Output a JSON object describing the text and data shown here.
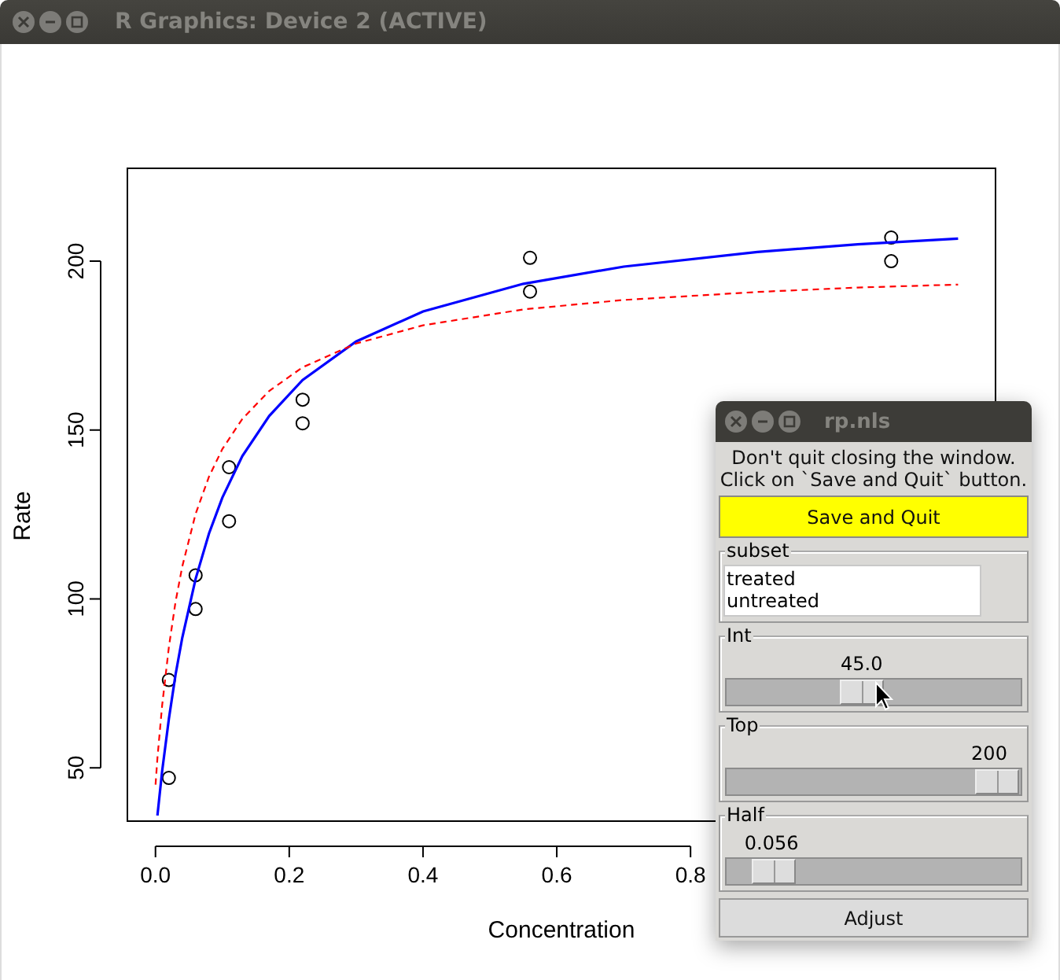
{
  "window": {
    "title": "R Graphics: Device 2 (ACTIVE)"
  },
  "plot": {
    "chart_data": {
      "type": "scatter",
      "xlabel": "Concentration",
      "ylabel": "Rate",
      "xlim": [
        -0.042,
        1.256
      ],
      "ylim": [
        34.2,
        227.5
      ],
      "xticks": [
        {
          "value": 0,
          "label": "0.0"
        },
        {
          "value": 0.2,
          "label": "0.2"
        },
        {
          "value": 0.4,
          "label": "0.4"
        },
        {
          "value": 0.6,
          "label": "0.6"
        },
        {
          "value": 0.8,
          "label": "0.8"
        }
      ],
      "yticks": [
        50,
        100,
        150,
        200
      ],
      "x": [
        0,
        0.003,
        0.01,
        0.02,
        0.03,
        0.04,
        0.06,
        0.08,
        0.1,
        0.13,
        0.17,
        0.22,
        0.3,
        0.4,
        0.55,
        0.7,
        0.9,
        1.05,
        1.2
      ],
      "series": [
        {
          "color": "#000000",
          "x": [
            0.02,
            0.02,
            0.06,
            0.06,
            0.11,
            0.11,
            0.22,
            0.22,
            0.56,
            0.56,
            1.1,
            1.1
          ],
          "values": [
            76,
            47,
            97,
            107,
            123,
            139,
            159,
            152,
            201,
            191,
            207,
            200
          ]
        },
        {
          "type": "line",
          "line_style": "solid",
          "color": "#0000ff",
          "values": [
            null,
            35.9,
            49,
            64.5,
            77.5,
            88.5,
            106,
            119.4,
            130,
            142.3,
            154.2,
            164.8,
            176.2,
            185.1,
            193.3,
            198.4,
            202.7,
            205,
            206.7
          ]
        },
        {
          "type": "line",
          "line_style": "dashed",
          "color": "#ff0000",
          "values": [
            45,
            52.9,
            68.5,
            85.8,
            99.1,
            109.6,
            125.2,
            136.2,
            144.4,
            153.3,
            161.6,
            168.6,
            175.6,
            181,
            185.7,
            188.5,
            190.9,
            192.2,
            193.1
          ]
        }
      ]
    }
  },
  "dialog": {
    "title": "rp.nls",
    "message": "Don't quit closing the window.\nClick on `Save and Quit` button.",
    "save_button": "Save and Quit",
    "subset": {
      "legend": "subset",
      "items": [
        {
          "label": "treated",
          "selected": false
        },
        {
          "label": "untreated",
          "selected": false
        }
      ]
    },
    "sliders": [
      {
        "legend": "Int",
        "reading": "45.0",
        "level": 0.46
      },
      {
        "legend": "Top",
        "reading": "200",
        "level": 0.92
      },
      {
        "legend": "Half",
        "reading": "0.056",
        "level": 0.16
      }
    ],
    "adjust_button": "Adjust"
  }
}
